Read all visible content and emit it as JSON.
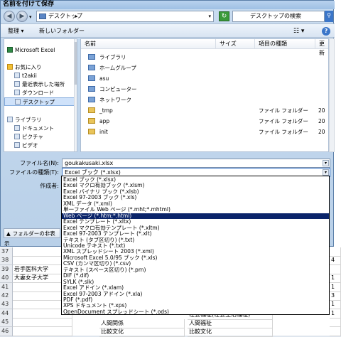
{
  "dialog": {
    "title": "名前を付けて保存",
    "address": "デスクトップ",
    "search_placeholder": "デスクトップの検索",
    "toolbar": {
      "organize": "整理 ▾",
      "new_folder": "新しいフォルダー"
    }
  },
  "nav": {
    "items": [
      {
        "label": "Microsoft Excel",
        "icon": "excel-icon"
      },
      {
        "label": "お気に入り",
        "icon": "star-icon"
      },
      {
        "label": "t2akii",
        "icon": "folder-icon"
      },
      {
        "label": "最近表示した場所",
        "icon": "recent-places-icon"
      },
      {
        "label": "ダウンロード",
        "icon": "download-icon"
      },
      {
        "label": "デスクトップ",
        "icon": "desktop-icon"
      },
      {
        "label": "ライブラリ",
        "icon": "library-icon"
      },
      {
        "label": "ドキュメント",
        "icon": "documents-icon"
      },
      {
        "label": "ピクチャ",
        "icon": "pictures-icon"
      },
      {
        "label": "ビデオ",
        "icon": "video-icon"
      }
    ]
  },
  "files": {
    "columns": [
      "名前",
      "サイズ",
      "項目の種類",
      "更新"
    ],
    "rows": [
      {
        "name": "ライブラリ",
        "type": "",
        "date": "",
        "icon": "library-icon"
      },
      {
        "name": "ホームグループ",
        "type": "",
        "date": "",
        "icon": "homegroup-icon"
      },
      {
        "name": "asu",
        "type": "",
        "date": "",
        "icon": "user-icon"
      },
      {
        "name": "コンピューター",
        "type": "",
        "date": "",
        "icon": "computer-icon"
      },
      {
        "name": "ネットワーク",
        "type": "",
        "date": "",
        "icon": "network-icon"
      },
      {
        "name": "_tmp",
        "type": "ファイル フォルダー",
        "date": "20",
        "icon": "folder-icon"
      },
      {
        "name": "app",
        "type": "ファイル フォルダー",
        "date": "20",
        "icon": "folder-icon"
      },
      {
        "name": "init",
        "type": "ファイル フォルダー",
        "date": "20",
        "icon": "folder-icon"
      }
    ]
  },
  "form": {
    "filename_label": "ファイル名(N):",
    "filename_value": "goukakusaki.xlsx",
    "filetype_label": "ファイルの種類(T):",
    "filetype_value": "Excel ブック (*.xlsx)",
    "author_label": "作成者:",
    "hide_folders": "フォルダーの非表示"
  },
  "dropdown": {
    "selected_index": 6,
    "options": [
      "Excel ブック (*.xlsx)",
      "Excel マクロ有効ブック (*.xlsm)",
      "Excel バイナリ ブック (*.xlsb)",
      "Excel 97-2003 ブック (*.xls)",
      "XML データ (*.xml)",
      "単一ファイル Web ページ (*.mht;*.mhtml)",
      "Web ページ (*.htm;*.html)",
      "Excel テンプレート (*.xltx)",
      "Excel マクロ有効テンプレート (*.xltm)",
      "Excel 97-2003 テンプレート (*.xlt)",
      "テキスト (タブ区切り) (*.txt)",
      "Unicode テキスト (*.txt)",
      "XML スプレッドシート 2003 (*.xml)",
      "Microsoft Excel 5.0/95 ブック (*.xls)",
      "CSV (カンマ区切り) (*.csv)",
      "テキスト (スペース区切り) (*.prn)",
      "DIF (*.dif)",
      "SYLK (*.slk)",
      "Excel アドイン (*.xlam)",
      "Excel 97-2003 アドイン (*.xla)",
      "PDF (*.pdf)",
      "XPS ドキュメント (*.xps)",
      "OpenDocument スプレッドシート (*.ods)"
    ]
  },
  "excel": {
    "rows": [
      {
        "num": "37",
        "a": "",
        "r": ""
      },
      {
        "num": "38",
        "a": "",
        "r": "4"
      },
      {
        "num": "39",
        "a": "岩手医科大学",
        "r": ""
      },
      {
        "num": "40",
        "a": "大妻女子大学",
        "r": "1"
      },
      {
        "num": "41",
        "a": "",
        "r": "1"
      },
      {
        "num": "42",
        "a": "",
        "r": "3"
      },
      {
        "num": "43",
        "a": "",
        "r": "1"
      },
      {
        "num": "44",
        "a": "",
        "r": "1"
      },
      {
        "num": "45",
        "a": "",
        "r": ""
      },
      {
        "num": "46",
        "a": "",
        "r": ""
      }
    ],
    "row45_b": "人間関係",
    "row45_c": "人間福祉",
    "row46_b": "比較文化",
    "row46_c": "比較文化",
    "row44_c": "社会福祉(社会生活福祉)",
    "row46_r": "2"
  }
}
